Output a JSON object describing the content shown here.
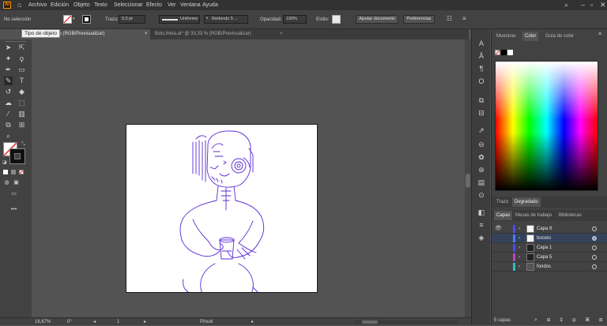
{
  "menubar": {
    "logo": "Ai",
    "items": [
      "Archivo",
      "Edición",
      "Objeto",
      "Texto",
      "Seleccionar",
      "Efecto",
      "Ver",
      "Ventana",
      "Ayuda"
    ]
  },
  "controlbar": {
    "selection_label": "No selección",
    "stroke_label": "Trazo:",
    "stroke_value": "0,5 pt",
    "profile_value": "Uniforme",
    "brush_value": "Redondo 5 ...",
    "opacity_label": "Opacidad:",
    "opacity_value": "100%",
    "style_label": "Estilo:",
    "adjust_doc_button": "Ajustar documento",
    "preferences_button": "Preferencias"
  },
  "tooltip": "Tipo de objeto",
  "tabs": [
    {
      "label": "* @ 16,67 % (RGB/Previsualizar)",
      "active": true
    },
    {
      "label": "Bots.theta.ai* @ 33,33 % (RGB/Previsualizar)",
      "active": false
    }
  ],
  "statusbar": {
    "zoom": "16,67%",
    "rotation": "0°",
    "artboard": "1",
    "tool": "Pincel"
  },
  "panels": {
    "top_tabs": [
      "Muestras",
      "Color",
      "Guía de color"
    ],
    "active_top_tab": "Color",
    "mid_tabs": [
      "Trazo",
      "Degradado"
    ],
    "active_mid_tab": "Degradado",
    "bottom_tabs": [
      "Capas",
      "Mesas de trabajo",
      "Bibliotecas"
    ],
    "active_bottom_tab": "Capas",
    "layers": [
      {
        "name": "Capa 9",
        "color": "#4a4aff",
        "visible": true,
        "selected": false
      },
      {
        "name": "boceto",
        "color": "#4a7cff",
        "visible": false,
        "selected": true
      },
      {
        "name": "Capa 1",
        "color": "#4a4aff",
        "visible": false,
        "selected": false
      },
      {
        "name": "Capa 5",
        "color": "#c040c0",
        "visible": false,
        "selected": false
      },
      {
        "name": "fondos",
        "color": "#30c0c0",
        "visible": false,
        "selected": false
      }
    ],
    "layers_count": "5 capas"
  },
  "colors": {
    "sketch": "#5a28d6"
  }
}
